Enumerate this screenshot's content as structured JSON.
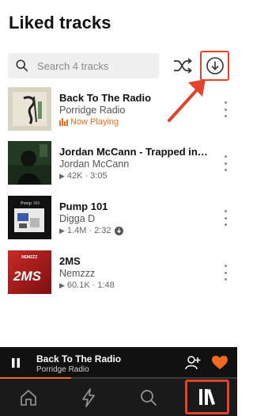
{
  "page": {
    "title": "Liked tracks"
  },
  "search": {
    "placeholder": "Search 4 tracks"
  },
  "tracks": [
    {
      "title": "Back To The Radio",
      "artist": "Porridge Radio",
      "status": "Now Playing",
      "now_playing": true
    },
    {
      "title": "Jordan McCann - Trapped in the...",
      "artist": "Jordan McCann",
      "plays": "42K",
      "duration": "3:05",
      "downloaded": false
    },
    {
      "title": "Pump 101",
      "artist": "Digga D",
      "plays": "1.4M",
      "duration": "2:32",
      "downloaded": true
    },
    {
      "title": "2MS",
      "artist": "Nemzzz",
      "plays": "60.1K",
      "duration": "1:48",
      "downloaded": false
    }
  ],
  "art_text": {
    "track3": "Pump 101",
    "track4_top": "NEMZZZ",
    "track4_main": "2MS"
  },
  "mini_player": {
    "title": "Back To The Radio",
    "artist": "Porridge Radio",
    "progress": 0.3
  },
  "nav": {
    "items": [
      "home-icon",
      "lightning-icon",
      "search-icon",
      "library-icon"
    ],
    "active": "library"
  },
  "colors": {
    "accent": "#f26a1b",
    "annotation": "#e2432a",
    "bar_bg": "#111111"
  }
}
